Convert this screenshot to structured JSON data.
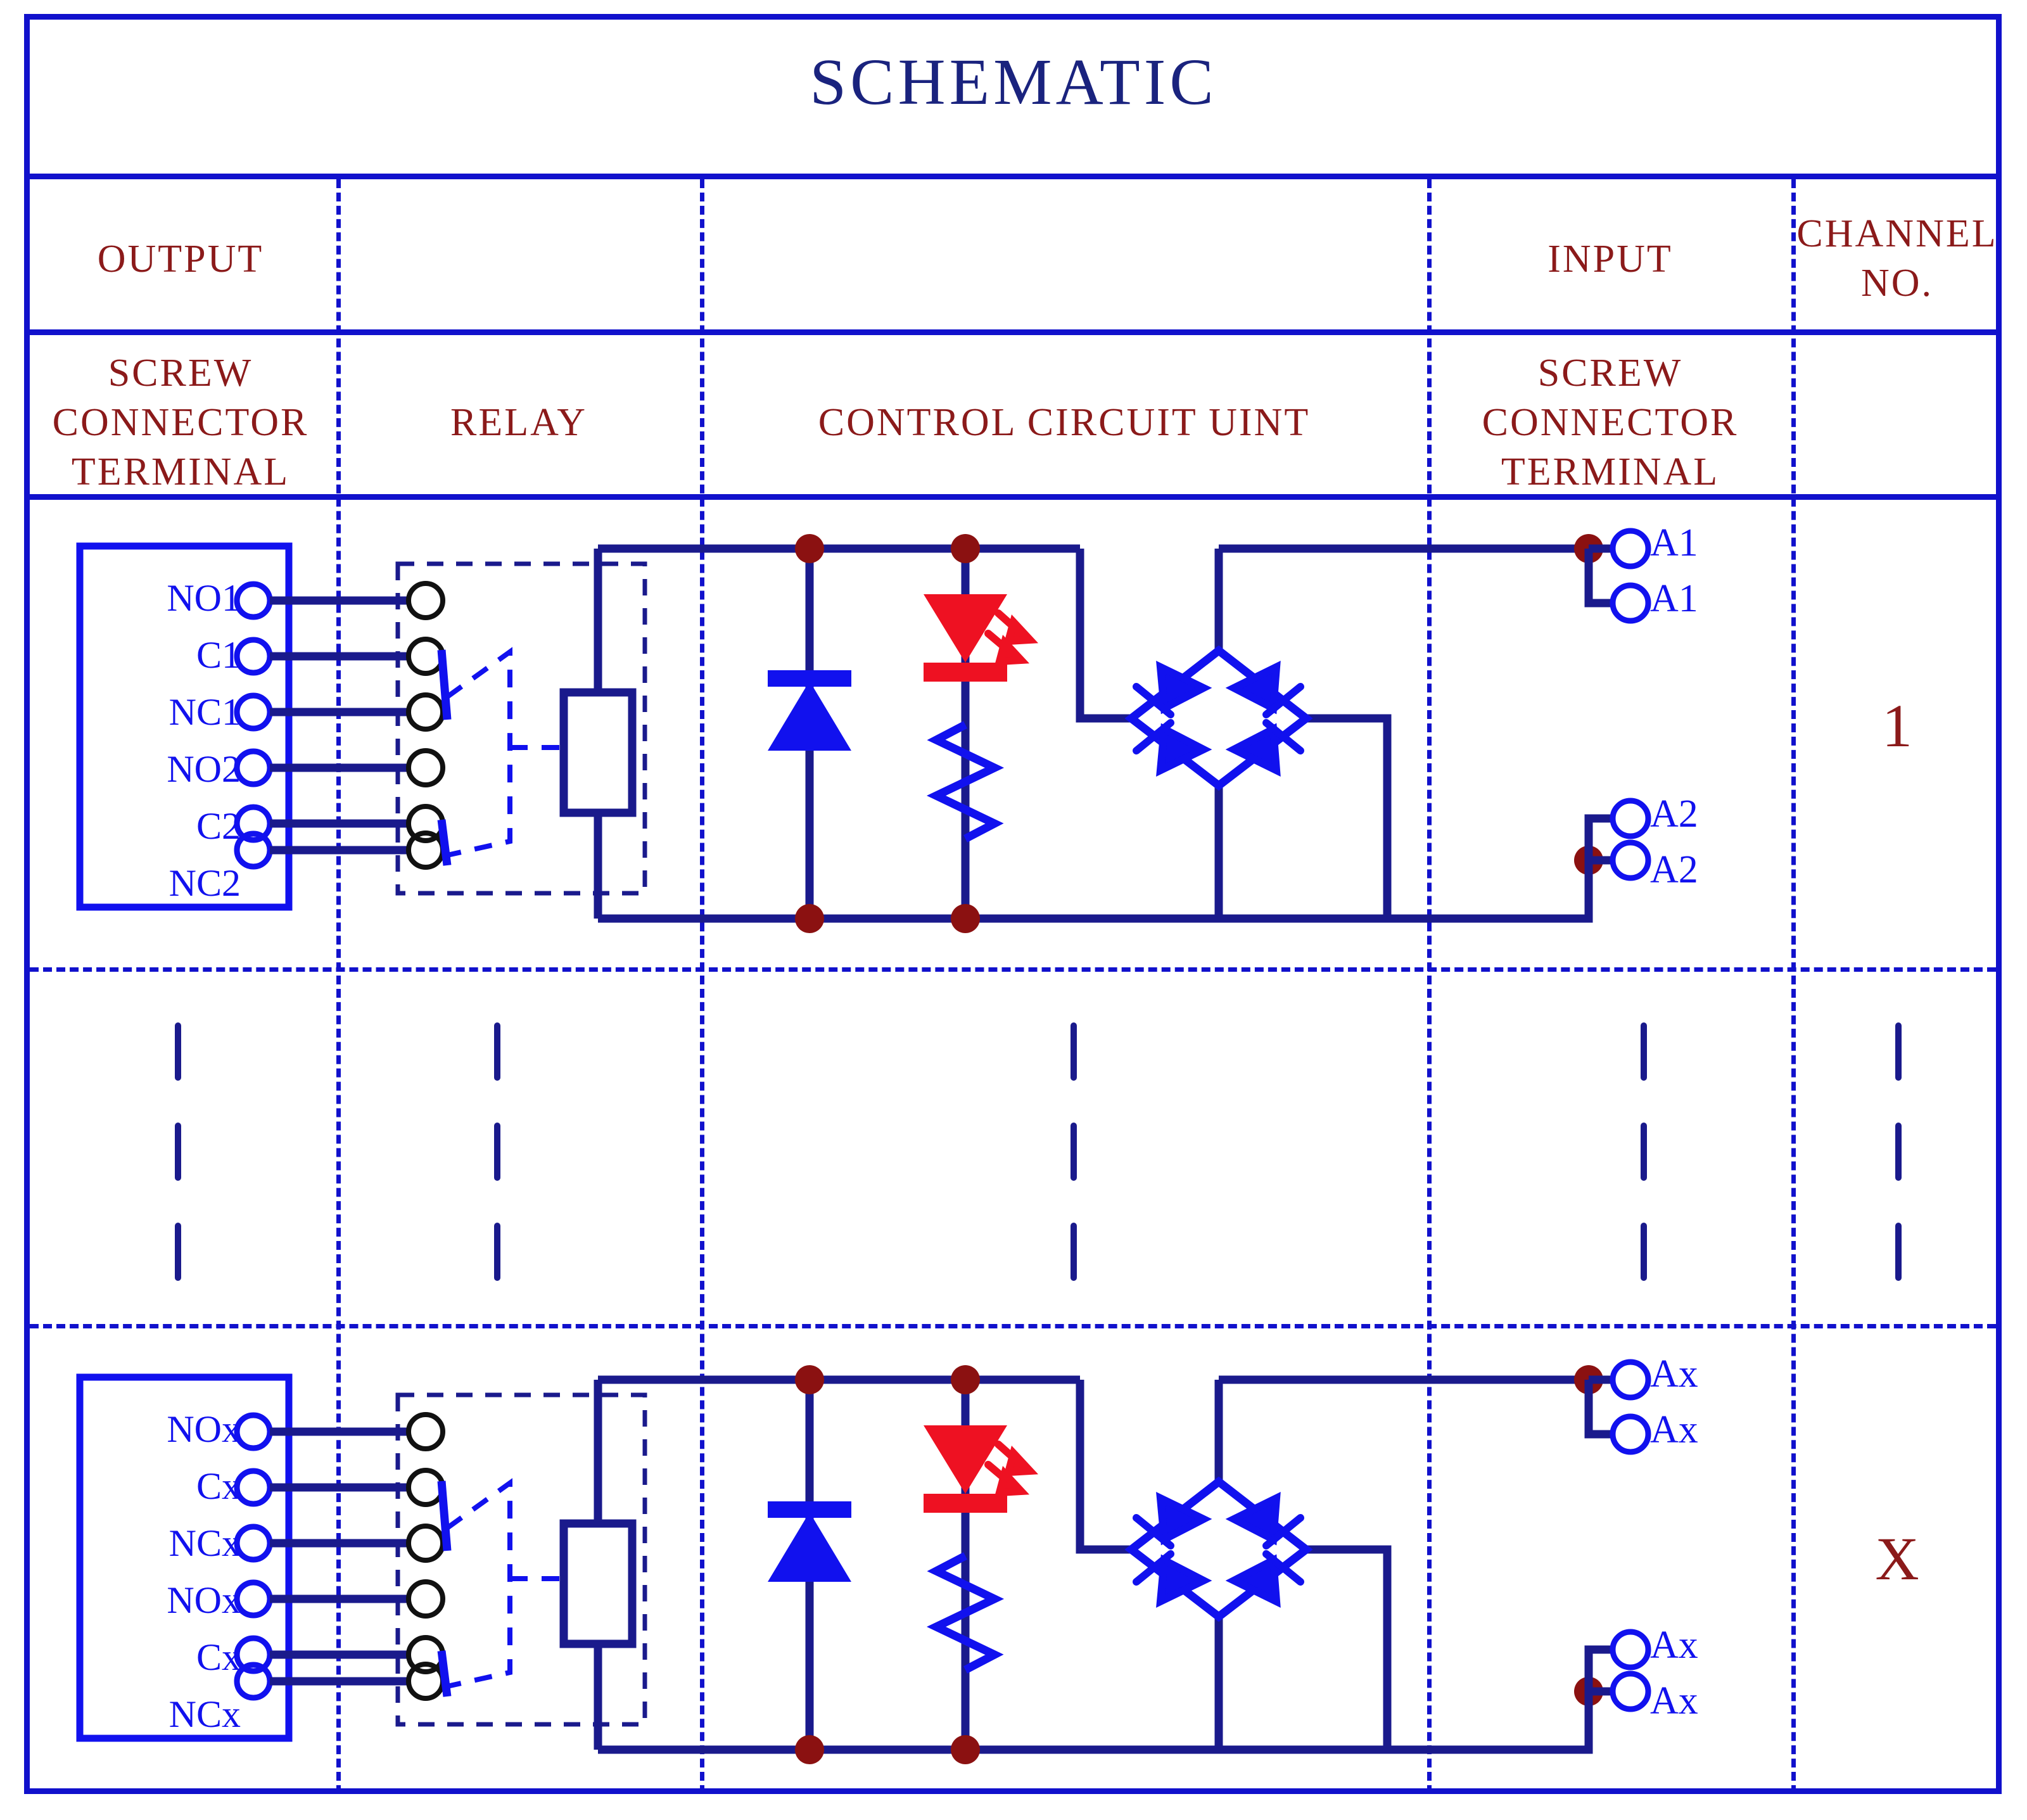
{
  "title": "SCHEMATIC",
  "colors": {
    "frame_blue": "#1111cc",
    "wire_navy": "#1a1a8c",
    "symbol_blue": "#1111ee",
    "label_maroon": "#8b1a1a",
    "led_red": "#ee1122",
    "junction_dot": "#8b1111",
    "title_blue": "#1a237e"
  },
  "header": {
    "group_row": {
      "output": "OUTPUT",
      "relay_group": "",
      "control_group": "",
      "input": "INPUT",
      "channel": "CHANNEL\nNO."
    },
    "columns": [
      {
        "label": "SCREW\nCONNECTOR\nTERMINAL",
        "name": "output-screw-connector-terminal"
      },
      {
        "label": "RELAY",
        "name": "relay"
      },
      {
        "label": "CONTROL CIRCUIT UINT",
        "name": "control-circuit-unit"
      },
      {
        "label": "SCREW\nCONNECTOR\nTERMINAL",
        "name": "input-screw-connector-terminal"
      },
      {
        "label": "",
        "name": "channel-no"
      }
    ]
  },
  "rows": [
    {
      "channel": "1",
      "output_terminals": [
        "NO1",
        "C1",
        "NC1",
        "NO2",
        "C2",
        "NC2"
      ],
      "input_terminals": [
        "A1",
        "A1",
        "A2",
        "A2"
      ],
      "components": {
        "relay_coil": "relay-coil",
        "flyback_diode": "flyback-diode",
        "indicator_led": "indicator-led",
        "series_resistor": "series-resistor",
        "bridge_rectifier": "bridge-rectifier"
      }
    },
    {
      "channel": "X",
      "output_terminals": [
        "NOx",
        "Cx",
        "NCx",
        "NOx",
        "Cx",
        "NCx"
      ],
      "input_terminals": [
        "Ax",
        "Ax",
        "Ax",
        "Ax"
      ],
      "components": {
        "relay_coil": "relay-coil",
        "flyback_diode": "flyback-diode",
        "indicator_led": "indicator-led",
        "series_resistor": "series-resistor",
        "bridge_rectifier": "bridge-rectifier"
      }
    }
  ],
  "ellipsis_row": {
    "marks": 3,
    "columns": 5
  }
}
